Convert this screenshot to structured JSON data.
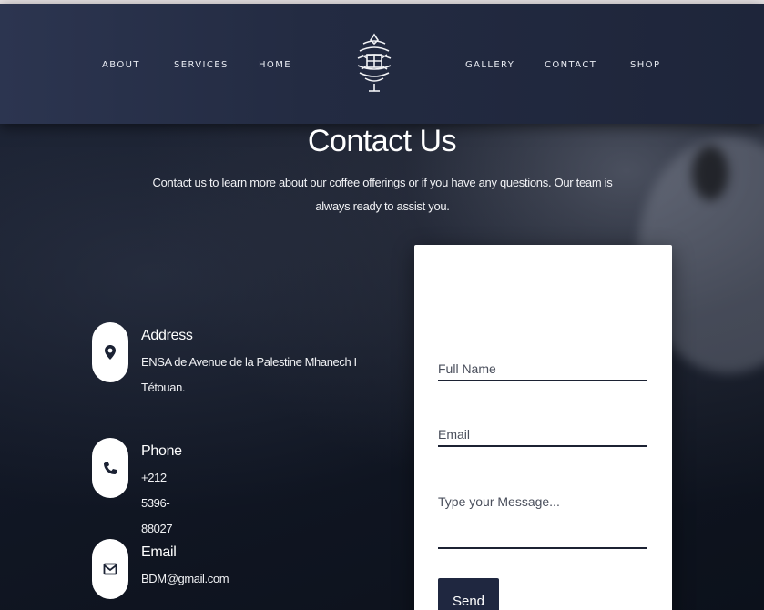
{
  "nav": {
    "left_links": [
      "ABOUT",
      "SERVICES",
      "HOME"
    ],
    "right_links": [
      "GALLERY",
      "CONTACT",
      "SHOP"
    ],
    "logo_icon": "ornamental-emblem-logo"
  },
  "hero": {
    "title": "Contact Us",
    "subtitle": "Contact us to learn more about our coffee offerings or if you have any questions. Our team is always ready to assist you."
  },
  "contact_info": {
    "address": {
      "icon": "map-pin-icon",
      "label": "Address",
      "value": "ENSA de Avenue de la Palestine Mhanech I Tétouan."
    },
    "phone": {
      "icon": "phone-icon",
      "label": "Phone",
      "value": "+212 5396-88027"
    },
    "email": {
      "icon": "envelope-icon",
      "label": "Email",
      "value": "BDM@gmail.com"
    }
  },
  "form": {
    "full_name_placeholder": "Full Name",
    "email_placeholder": "Email",
    "message_placeholder": "Type your Message...",
    "send_label": "Send"
  },
  "colors": {
    "navbar": "#232b42",
    "background": "#121826",
    "card": "#ffffff",
    "button": "#1f2740"
  }
}
